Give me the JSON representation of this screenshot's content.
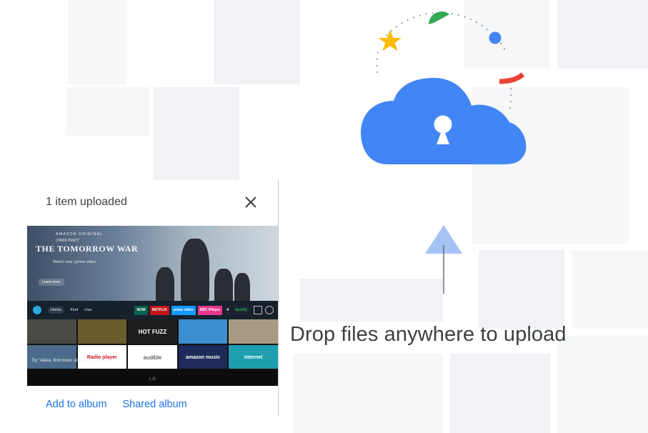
{
  "upload_panel": {
    "title": "1 item uploaded",
    "close_icon": "close-icon",
    "actions": {
      "add_to_album": "Add to album",
      "shared_album": "Shared album"
    },
    "thumbnail": {
      "kicker": "AMAZON ORIGINAL",
      "subtitle": "CHRIS PRATT",
      "title": "THE TOMORROW WAR",
      "watch": "Watch now | prime video",
      "learn_more": "Learn more",
      "nav": [
        "Home",
        "Find",
        "Live"
      ],
      "apps": [
        "NOW",
        "NETFLIX",
        "prime video",
        "BBC iPlayer",
        "4",
        "Spotify"
      ],
      "row1": [
        "",
        "",
        "HOT FUZZ",
        "",
        ""
      ],
      "row2": [
        "",
        "Radio player",
        "audible",
        "amazon music",
        "internet"
      ],
      "hint": "Try \"Alexa, find music videos on YouTube\"",
      "brand": "LG"
    }
  },
  "drop_overlay": {
    "message": "Drop files anywhere to upload",
    "illustration_icon": "cloud-lock-icon",
    "arrow_icon": "upload-arrow-icon"
  },
  "colors": {
    "google_blue": "#4285f4",
    "google_red": "#ea4335",
    "google_yellow": "#fbbc04",
    "google_green": "#34a853",
    "link_blue": "#1a73e8",
    "text_dark": "#3c4043"
  }
}
